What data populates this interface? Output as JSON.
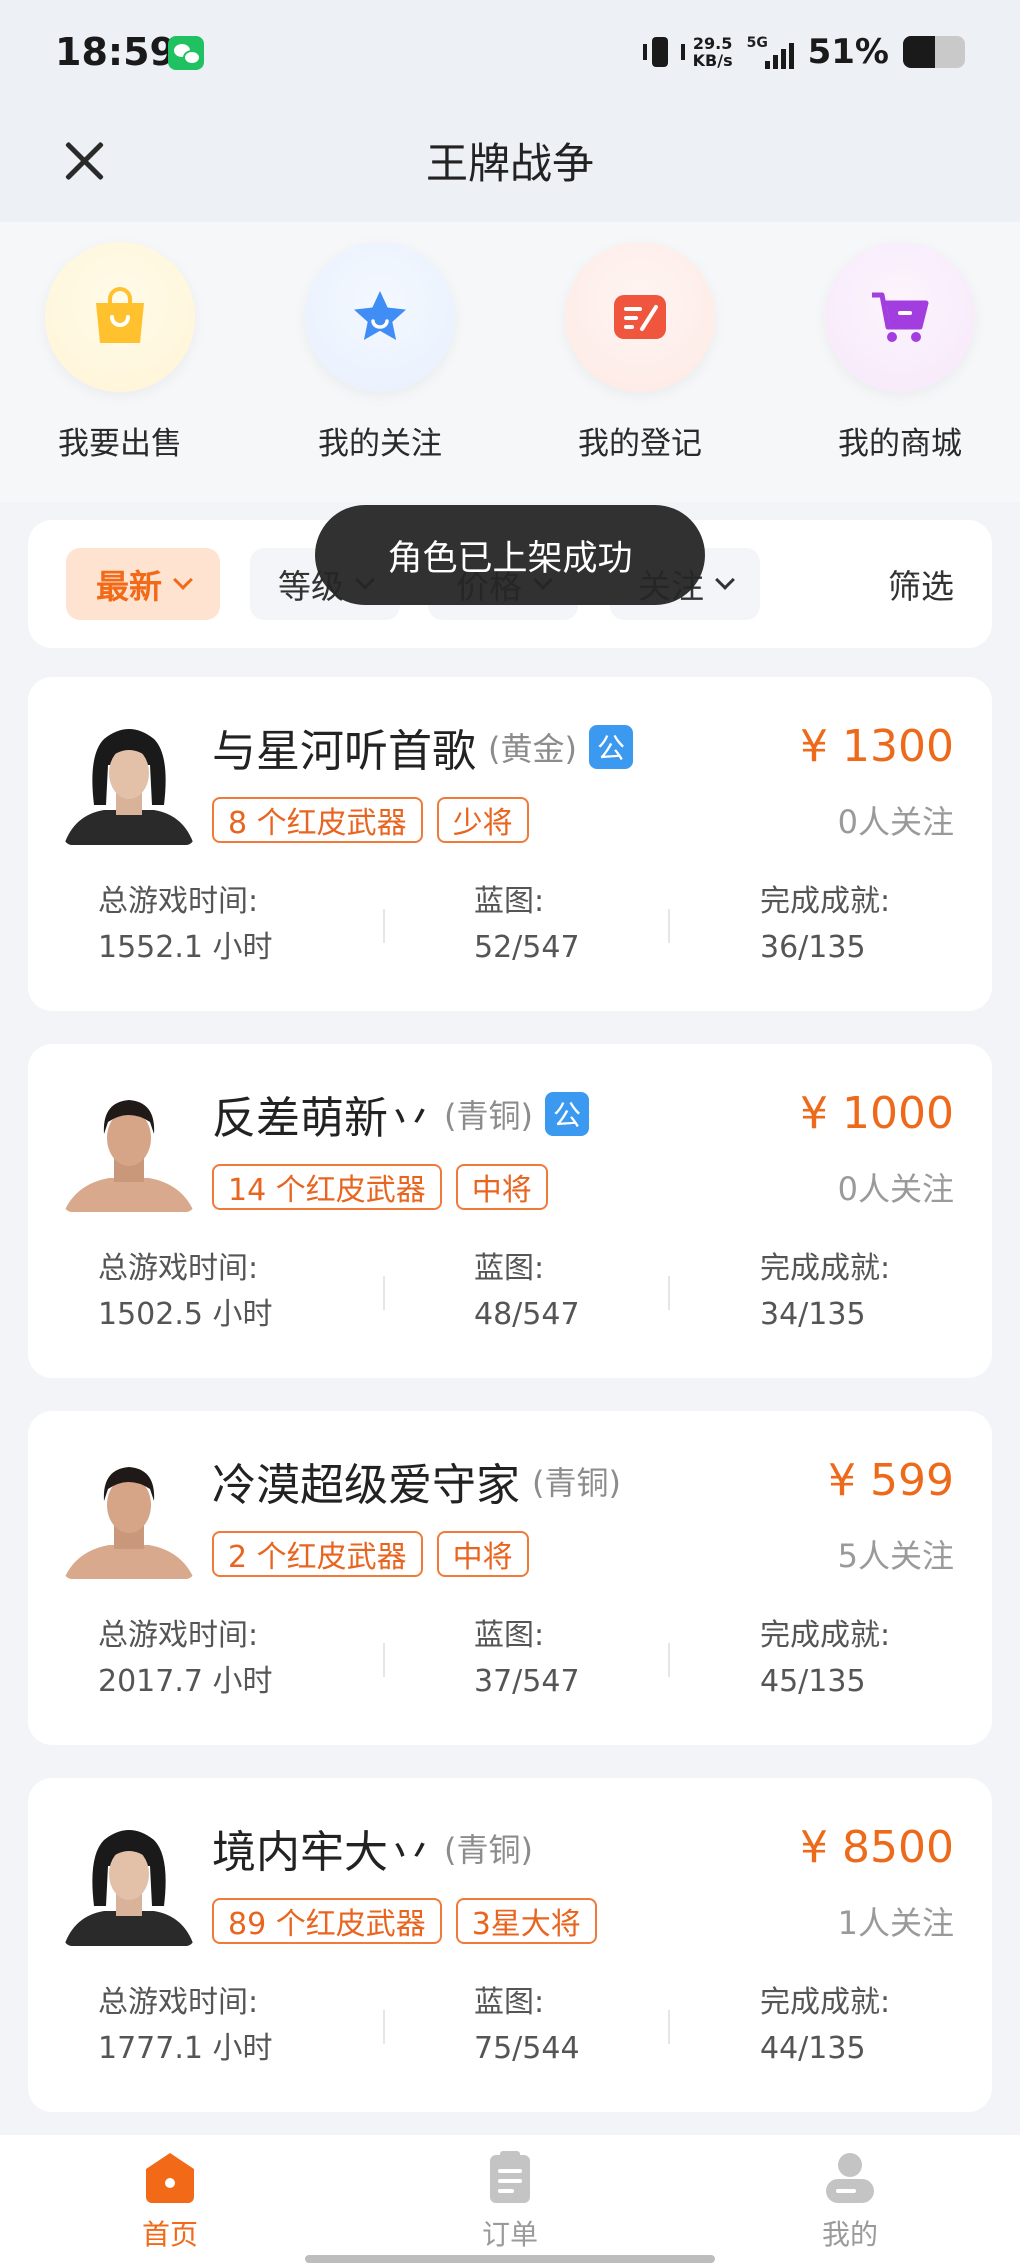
{
  "status_bar": {
    "time": "18:59",
    "net_speed_value": "29.5",
    "net_speed_unit": "KB/s",
    "network": "5G",
    "battery_percent": "51%",
    "battery_level": 0.51
  },
  "header": {
    "title": "王牌战争"
  },
  "quick_actions": [
    {
      "label": "我要出售",
      "icon": "shopping-bag-icon",
      "color": "#ffbf2a"
    },
    {
      "label": "我的关注",
      "icon": "star-icon",
      "color": "#3f8df5"
    },
    {
      "label": "我的登记",
      "icon": "edit-note-icon",
      "color": "#f0553e"
    },
    {
      "label": "我的商城",
      "icon": "cart-icon",
      "color": "#a23ee0"
    }
  ],
  "filters": {
    "chips": [
      "最新",
      "等级",
      "价格",
      "关注"
    ],
    "active": "最新",
    "filter_label": "筛选"
  },
  "toast": "角色已上架成功",
  "listings": [
    {
      "name": "与星河听首歌",
      "rank": "(黄金)",
      "badge": "公",
      "weapons": "8 个红皮武器",
      "title": "少将",
      "price": "¥ 1300",
      "followers": "0人关注",
      "playtime_label": "总游戏时间:",
      "playtime": "1552.1 小时",
      "blueprint_label": "蓝图:",
      "blueprint": "52/547",
      "achieve_label": "完成成就:",
      "achieve": "36/135"
    },
    {
      "name": "反差萌新丷",
      "rank": "(青铜)",
      "badge": "公",
      "weapons": "14 个红皮武器",
      "title": "中将",
      "price": "¥ 1000",
      "followers": "0人关注",
      "playtime_label": "总游戏时间:",
      "playtime": "1502.5 小时",
      "blueprint_label": "蓝图:",
      "blueprint": "48/547",
      "achieve_label": "完成成就:",
      "achieve": "34/135"
    },
    {
      "name": "冷漠超级爱守家",
      "rank": "(青铜)",
      "badge": "",
      "weapons": "2 个红皮武器",
      "title": "中将",
      "price": "¥ 599",
      "followers": "5人关注",
      "playtime_label": "总游戏时间:",
      "playtime": "2017.7 小时",
      "blueprint_label": "蓝图:",
      "blueprint": "37/547",
      "achieve_label": "完成成就:",
      "achieve": "45/135"
    },
    {
      "name": "境内牢大丷",
      "rank": "(青铜)",
      "badge": "",
      "weapons": "89 个红皮武器",
      "title": "3星大将",
      "price": "¥ 8500",
      "followers": "1人关注",
      "playtime_label": "总游戏时间:",
      "playtime": "1777.1 小时",
      "blueprint_label": "蓝图:",
      "blueprint": "75/544",
      "achieve_label": "完成成就:",
      "achieve": "44/135"
    }
  ],
  "bottom_nav": [
    {
      "label": "首页",
      "icon": "home-icon",
      "active": true
    },
    {
      "label": "订单",
      "icon": "order-clipboard-icon",
      "active": false
    },
    {
      "label": "我的",
      "icon": "profile-icon",
      "active": false
    }
  ],
  "colors": {
    "accent": "#f26a18",
    "badge_blue": "#3b9af0",
    "price": "#ee6a1b"
  }
}
